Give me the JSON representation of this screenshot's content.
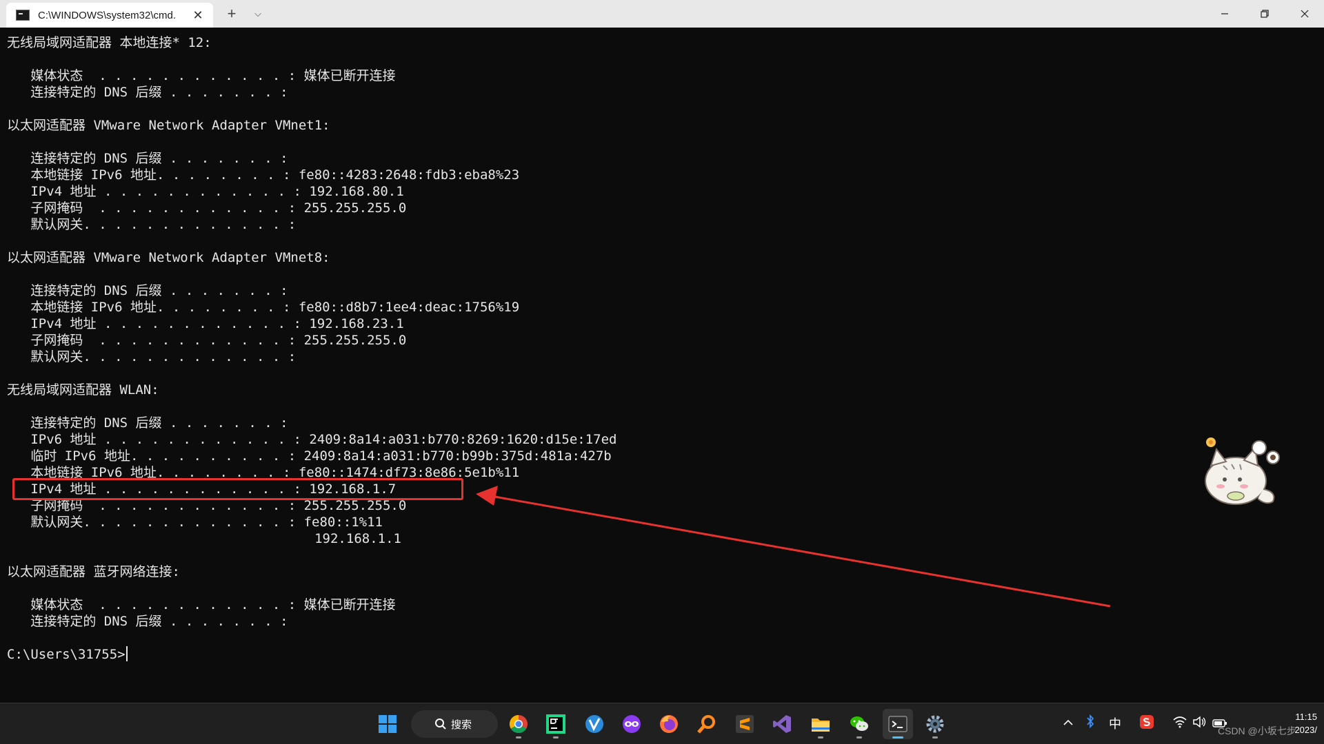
{
  "window": {
    "tab_title": "C:\\WINDOWS\\system32\\cmd.",
    "tab_close_glyph": "✕",
    "new_tab_glyph": "+",
    "tab_menu_glyph": "⌵"
  },
  "console": {
    "lines": [
      "无线局域网适配器 本地连接* 12:",
      "",
      "   媒体状态  . . . . . . . . . . . . : 媒体已断开连接",
      "   连接特定的 DNS 后缀 . . . . . . . :",
      "",
      "以太网适配器 VMware Network Adapter VMnet1:",
      "",
      "   连接特定的 DNS 后缀 . . . . . . . :",
      "   本地链接 IPv6 地址. . . . . . . . : fe80::4283:2648:fdb3:eba8%23",
      "   IPv4 地址 . . . . . . . . . . . . : 192.168.80.1",
      "   子网掩码  . . . . . . . . . . . . : 255.255.255.0",
      "   默认网关. . . . . . . . . . . . . :",
      "",
      "以太网适配器 VMware Network Adapter VMnet8:",
      "",
      "   连接特定的 DNS 后缀 . . . . . . . :",
      "   本地链接 IPv6 地址. . . . . . . . : fe80::d8b7:1ee4:deac:1756%19",
      "   IPv4 地址 . . . . . . . . . . . . : 192.168.23.1",
      "   子网掩码  . . . . . . . . . . . . : 255.255.255.0",
      "   默认网关. . . . . . . . . . . . . :",
      "",
      "无线局域网适配器 WLAN:",
      "",
      "   连接特定的 DNS 后缀 . . . . . . . :",
      "   IPv6 地址 . . . . . . . . . . . . : 2409:8a14:a031:b770:8269:1620:d15e:17ed",
      "   临时 IPv6 地址. . . . . . . . . . : 2409:8a14:a031:b770:b99b:375d:481a:427b",
      "   本地链接 IPv6 地址. . . . . . . . : fe80::1474:df73:8e86:5e1b%11",
      "   IPv4 地址 . . . . . . . . . . . . : 192.168.1.7",
      "   子网掩码  . . . . . . . . . . . . : 255.255.255.0",
      "   默认网关. . . . . . . . . . . . . : fe80::1%11",
      "                                       192.168.1.1",
      "",
      "以太网适配器 蓝牙网络连接:",
      "",
      "   媒体状态  . . . . . . . . . . . . : 媒体已断开连接",
      "   连接特定的 DNS 后缀 . . . . . . . :",
      ""
    ],
    "prompt": "C:\\Users\\31755>"
  },
  "annotation": {
    "color": "#e8322f"
  },
  "taskbar": {
    "search_label": "搜索",
    "ime_label": "中",
    "clock_time": "11:15",
    "clock_date": "2023/",
    "watermark": "CSDN @小坂七步",
    "apps": [
      {
        "name": "start-icon"
      },
      {
        "name": "chrome-icon"
      },
      {
        "name": "pycharm-icon"
      },
      {
        "name": "vscode-alt-icon"
      },
      {
        "name": "vpn-mask-icon"
      },
      {
        "name": "firefox-icon"
      },
      {
        "name": "everything-search-icon"
      },
      {
        "name": "sublime-text-icon"
      },
      {
        "name": "visual-studio-icon"
      },
      {
        "name": "file-explorer-icon"
      },
      {
        "name": "wechat-icon"
      },
      {
        "name": "terminal-icon"
      },
      {
        "name": "settings-icon"
      }
    ]
  },
  "colors": {
    "console_bg": "#0c0c0c",
    "console_fg": "#e6e6e6",
    "taskbar_bg": "#202020",
    "accent": "#4cc2ff"
  }
}
